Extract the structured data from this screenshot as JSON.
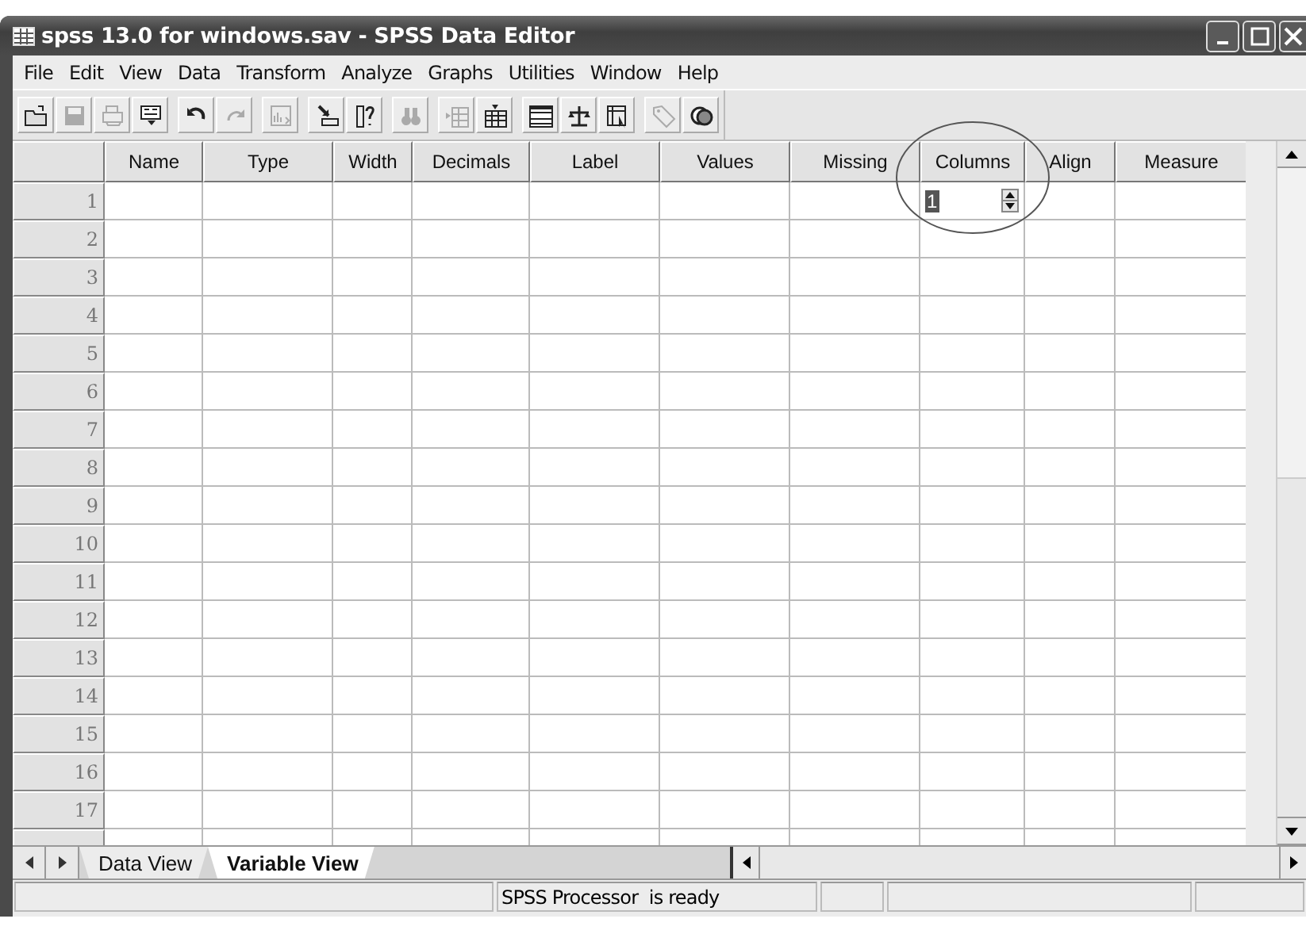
{
  "window": {
    "title": "spss 13.0 for windows.sav - SPSS Data Editor"
  },
  "menu": [
    "File",
    "Edit",
    "View",
    "Data",
    "Transform",
    "Analyze",
    "Graphs",
    "Utilities",
    "Window",
    "Help"
  ],
  "toolbar": {
    "groups": [
      {
        "buttons": [
          {
            "kind": "open",
            "disabled": false
          },
          {
            "kind": "save",
            "disabled": true
          },
          {
            "kind": "print",
            "disabled": true
          },
          {
            "kind": "recall",
            "disabled": false
          }
        ]
      },
      {
        "buttons": [
          {
            "kind": "undo",
            "disabled": false
          },
          {
            "kind": "redo",
            "disabled": true
          }
        ]
      },
      {
        "buttons": [
          {
            "kind": "chart",
            "disabled": true
          }
        ]
      },
      {
        "buttons": [
          {
            "kind": "gotocase",
            "disabled": false
          },
          {
            "kind": "variables",
            "disabled": false
          }
        ]
      },
      {
        "buttons": [
          {
            "kind": "find",
            "disabled": true
          }
        ]
      },
      {
        "buttons": [
          {
            "kind": "insertcase",
            "disabled": true
          },
          {
            "kind": "insertvar",
            "disabled": false
          }
        ]
      },
      {
        "buttons": [
          {
            "kind": "split",
            "disabled": false
          },
          {
            "kind": "weight",
            "disabled": false
          },
          {
            "kind": "select",
            "disabled": false
          }
        ]
      },
      {
        "buttons": [
          {
            "kind": "labels",
            "disabled": true
          },
          {
            "kind": "sets",
            "disabled": false
          }
        ]
      }
    ]
  },
  "grid": {
    "columns": [
      {
        "label": "Name"
      },
      {
        "label": "Type"
      },
      {
        "label": "Width"
      },
      {
        "label": "Decimals"
      },
      {
        "label": "Label"
      },
      {
        "label": "Values"
      },
      {
        "label": "Missing"
      },
      {
        "label": "Columns",
        "editor": {
          "value": "1",
          "text_selected": true
        }
      },
      {
        "label": "Align"
      },
      {
        "label": "Measure"
      }
    ],
    "rows": [
      "1",
      "2",
      "3",
      "4",
      "5",
      "6",
      "7",
      "8",
      "9",
      "10",
      "11",
      "12",
      "13",
      "14",
      "15",
      "16",
      "17"
    ],
    "annotation": {
      "kind": "circle"
    }
  },
  "tabs": [
    {
      "label": "Data View",
      "selected": false
    },
    {
      "label": "Variable View",
      "selected": true
    }
  ],
  "status_bar": {
    "message": "SPSS Processor  is ready"
  }
}
